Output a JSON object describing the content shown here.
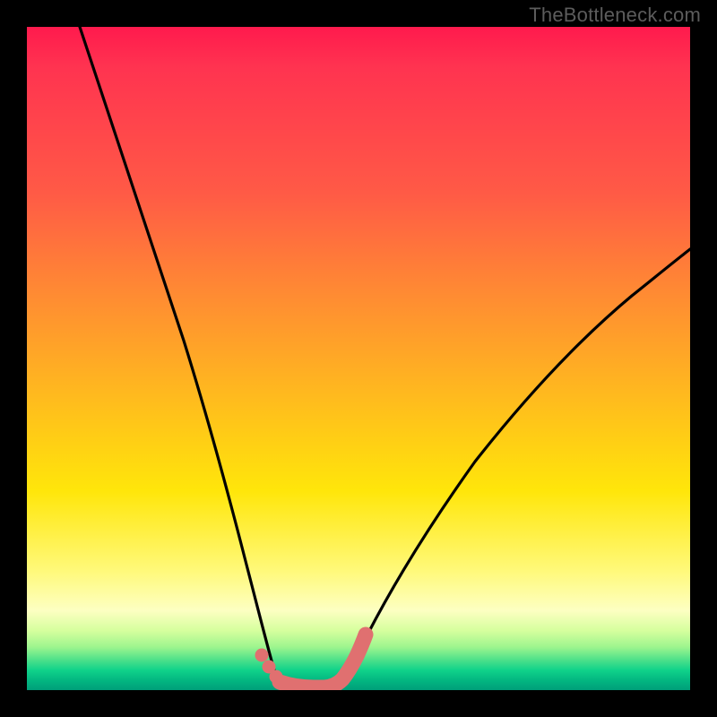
{
  "watermark": "TheBottleneck.com",
  "chart_data": {
    "type": "line",
    "title": "",
    "xlabel": "",
    "ylabel": "",
    "xlim": [
      0,
      100
    ],
    "ylim": [
      0,
      100
    ],
    "grid": false,
    "legend": false,
    "series": [
      {
        "name": "left-curve",
        "stroke": "#000000",
        "x": [
          8,
          12,
          16,
          20,
          24,
          28,
          31,
          33,
          35,
          36.5,
          38
        ],
        "values": [
          100,
          86,
          72,
          58,
          45,
          32,
          20,
          12,
          6,
          2.5,
          0.5
        ]
      },
      {
        "name": "right-curve",
        "stroke": "#000000",
        "x": [
          46,
          48,
          51,
          55,
          60,
          66,
          73,
          81,
          90,
          100
        ],
        "values": [
          0.5,
          3,
          9,
          17,
          27,
          37,
          47,
          56,
          63,
          69
        ]
      },
      {
        "name": "flat-bottom-highlight",
        "stroke": "#e57373",
        "x": [
          35,
          36,
          37,
          38,
          39,
          40,
          41,
          42,
          43,
          44,
          45,
          46,
          47,
          48,
          49,
          50
        ],
        "values": [
          5,
          3,
          1.5,
          0.8,
          0.5,
          0.4,
          0.4,
          0.4,
          0.4,
          0.5,
          0.8,
          1.5,
          3,
          5,
          7,
          9.5
        ]
      }
    ],
    "background_gradient_stops": [
      {
        "pos": 0,
        "color": "#ff1a4d"
      },
      {
        "pos": 0.25,
        "color": "#ff5a46"
      },
      {
        "pos": 0.55,
        "color": "#ffb81f"
      },
      {
        "pos": 0.82,
        "color": "#fff97a"
      },
      {
        "pos": 0.95,
        "color": "#4be08a"
      },
      {
        "pos": 1.0,
        "color": "#009e79"
      }
    ]
  }
}
